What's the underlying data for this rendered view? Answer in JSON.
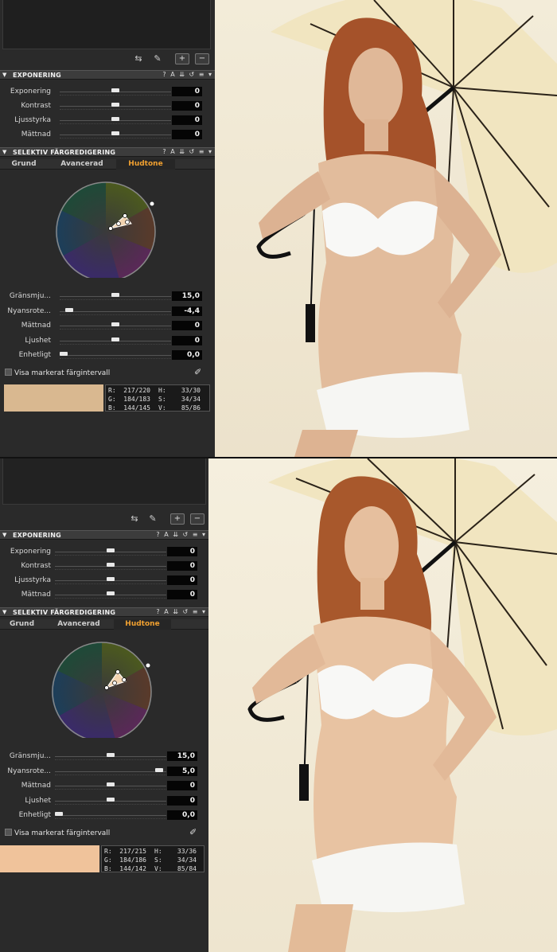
{
  "panels": [
    {
      "section_exposure": {
        "title": "EXPONERING"
      },
      "exposure_sliders": [
        {
          "label": "Exponering",
          "value": "0"
        },
        {
          "label": "Kontrast",
          "value": "0"
        },
        {
          "label": "Ljusstyrka",
          "value": "0"
        },
        {
          "label": "Mättnad",
          "value": "0"
        }
      ],
      "section_color": {
        "title": "SELEKTIV FÄRGREDIGERING"
      },
      "tabs": [
        "Grund",
        "Avancerad",
        "Hudtone"
      ],
      "active_tab": "Hudtone",
      "color_sliders": [
        {
          "label": "Gränsmju...",
          "value": "15,0",
          "level": 0.5
        },
        {
          "label": "Nyansrote...",
          "value": "-4,4",
          "level": 0.05
        },
        {
          "label": "Mättnad",
          "value": "0",
          "level": 0.5
        },
        {
          "label": "Ljushet",
          "value": "0",
          "level": 0.5
        },
        {
          "label": "Enhetligt",
          "value": "0,0",
          "level": 0.0
        }
      ],
      "checkbox_label": "Visa markerat färgintervall",
      "info": {
        "r": "R:  217/220",
        "g": "G:  184/183",
        "b": "B:  144/145",
        "h": "H:    33/30",
        "s": "S:    34/34",
        "v": "V:    85/86"
      }
    },
    {
      "section_exposure": {
        "title": "EXPONERING"
      },
      "exposure_sliders": [
        {
          "label": "Exponering",
          "value": "0"
        },
        {
          "label": "Kontrast",
          "value": "0"
        },
        {
          "label": "Ljusstyrka",
          "value": "0"
        },
        {
          "label": "Mättnad",
          "value": "0"
        }
      ],
      "section_color": {
        "title": "SELEKTIV FÄRGREDIGERING"
      },
      "tabs": [
        "Grund",
        "Avancerad",
        "Hudtone"
      ],
      "active_tab": "Hudtone",
      "color_sliders": [
        {
          "label": "Gränsmju...",
          "value": "15,0",
          "level": 0.5
        },
        {
          "label": "Nyansrote...",
          "value": "5,0",
          "level": 0.97
        },
        {
          "label": "Mättnad",
          "value": "0",
          "level": 0.5
        },
        {
          "label": "Ljushet",
          "value": "0",
          "level": 0.5
        },
        {
          "label": "Enhetligt",
          "value": "0,0",
          "level": 0.0
        }
      ],
      "checkbox_label": "Visa markerat färgintervall",
      "info": {
        "r": "R:  217/215",
        "g": "G:  184/186",
        "b": "B:  144/142",
        "h": "H:    33/36",
        "s": "S:    34/34",
        "v": "V:    85/84"
      }
    }
  ],
  "colors": {
    "accent_tab": "#f0a030",
    "swatch_before": "#d9b890",
    "swatch_after": "#f0c39b",
    "panel_bg": "#2a2a2a"
  },
  "icons": {
    "tools": [
      "adjust-sliders-icon",
      "color-picker-icon"
    ],
    "section": [
      "help-icon",
      "auto-icon",
      "copy-icon",
      "reset-icon",
      "menu-icon"
    ]
  },
  "toolbar": {
    "add": "+",
    "remove": "−"
  }
}
